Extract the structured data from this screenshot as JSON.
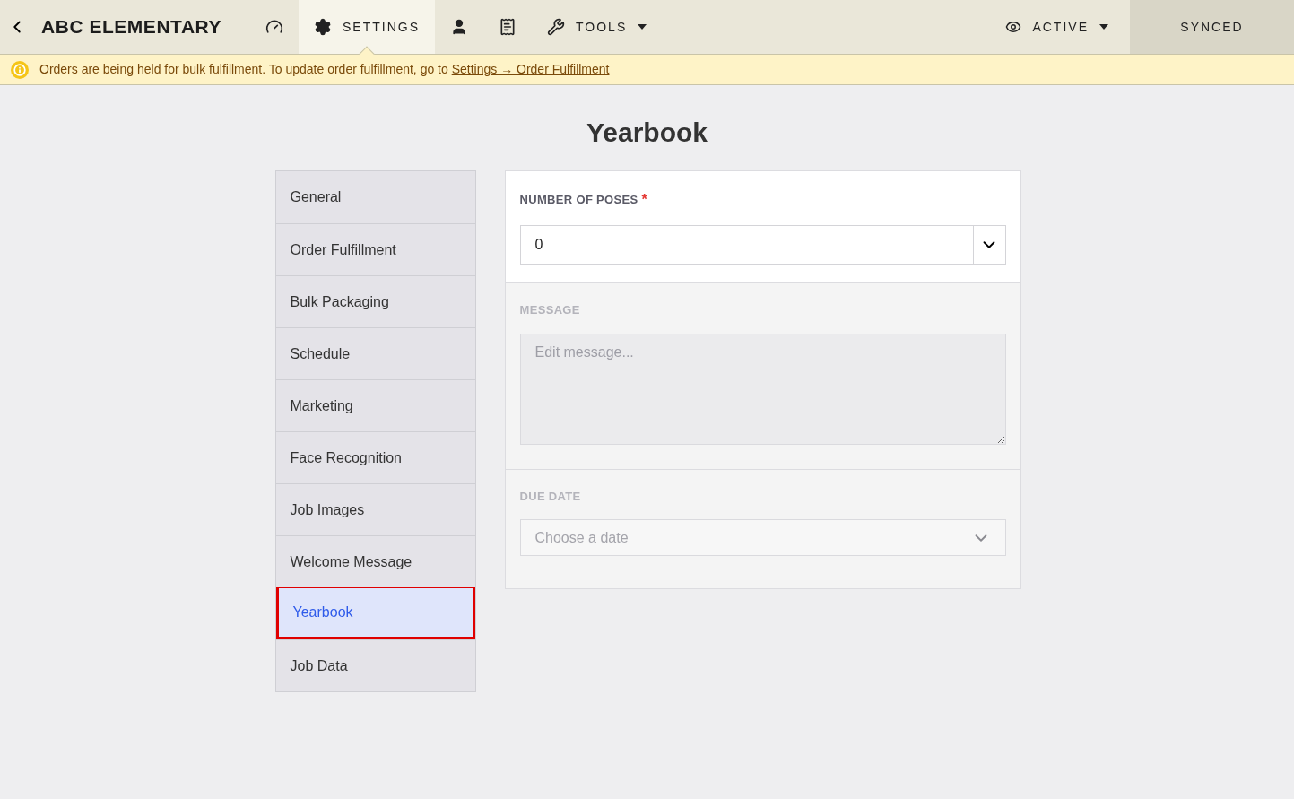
{
  "header": {
    "title": "ABC ELEMENTARY",
    "nav": [
      {
        "selected": false
      },
      {
        "label": "SETTINGS",
        "selected": true
      },
      {
        "selected": false
      },
      {
        "selected": false
      },
      {
        "label": "TOOLS",
        "selected": false,
        "dropdown": true
      }
    ],
    "status": {
      "label": "ACTIVE"
    },
    "sync": "SYNCED"
  },
  "banner": {
    "text": "Orders are being held for bulk fulfillment. To update order fulfillment, go to",
    "link": "Settings → Order Fulfillment"
  },
  "page_title": "Yearbook",
  "sidebar": {
    "items": [
      {
        "label": "General",
        "selected": false
      },
      {
        "label": "Order Fulfillment",
        "selected": false
      },
      {
        "label": "Bulk Packaging",
        "selected": false
      },
      {
        "label": "Schedule",
        "selected": false
      },
      {
        "label": "Marketing",
        "selected": false
      },
      {
        "label": "Face Recognition",
        "selected": false
      },
      {
        "label": "Job Images",
        "selected": false
      },
      {
        "label": "Welcome Message",
        "selected": false
      },
      {
        "label": "Yearbook",
        "selected": true
      },
      {
        "label": "Job Data",
        "selected": false
      }
    ]
  },
  "form": {
    "fields": [
      {
        "kind": "select",
        "label": "NUMBER OF POSES",
        "required_mark": "*",
        "value": "0",
        "disabled": false
      },
      {
        "kind": "textarea",
        "label": "MESSAGE",
        "placeholder": "Edit message...",
        "disabled": true
      },
      {
        "kind": "date",
        "label": "DUE DATE",
        "placeholder": "Choose a date",
        "disabled": true
      }
    ]
  }
}
